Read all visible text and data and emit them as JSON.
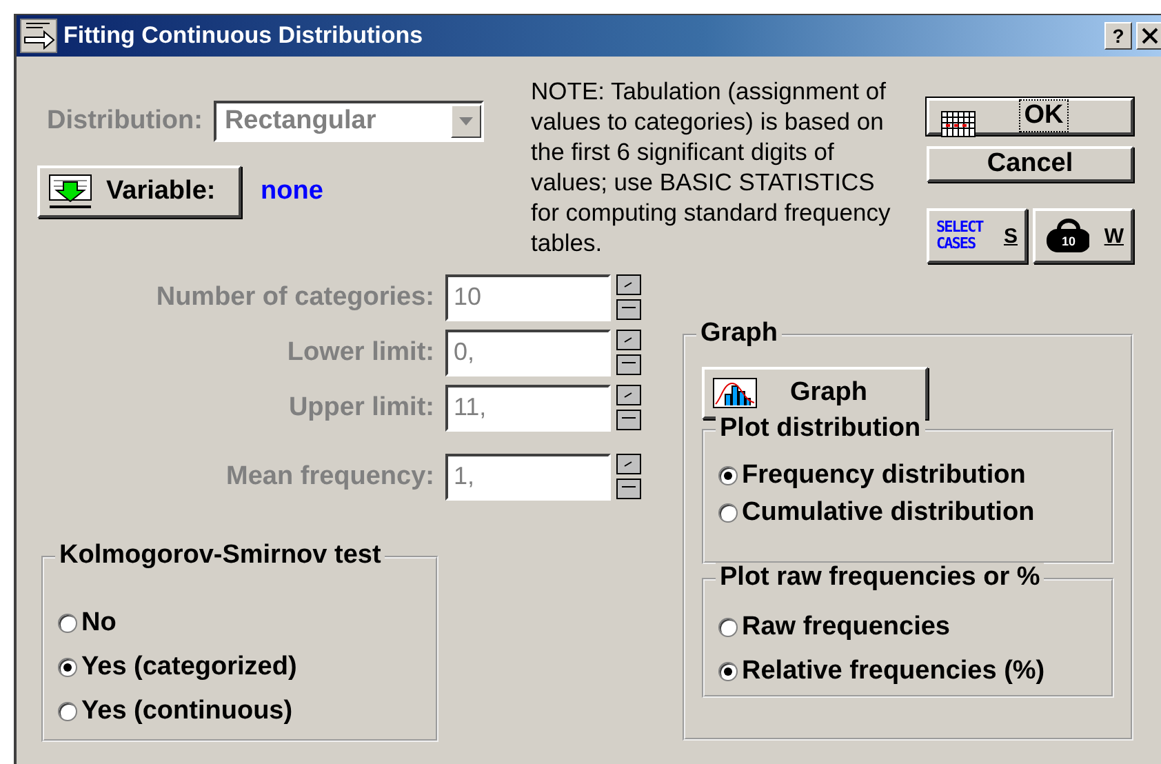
{
  "window": {
    "title": "Fitting Continuous Distributions",
    "help": "?"
  },
  "distribution": {
    "label": "Distribution:",
    "value": "Rectangular",
    "disabled": true
  },
  "variable": {
    "button": "Variable:",
    "value": "none"
  },
  "note_lines": [
    "NOTE: Tabulation (assignment of",
    "values to categories) is based on",
    "the first 6 significant digits of",
    "values; use BASIC STATISTICS",
    "for computing standard frequency",
    "tables."
  ],
  "buttons": [
    {
      "kind": "ok",
      "label": "OK",
      "default": true
    },
    {
      "kind": "cancel",
      "label": "Cancel",
      "default": false
    }
  ],
  "tool_buttons": [
    {
      "kind": "select_cases",
      "caption": "SELECT CASES",
      "label": "S"
    },
    {
      "kind": "weight",
      "caption": "10",
      "label": "W"
    }
  ],
  "fields": [
    {
      "label": "Number of categories:",
      "value": "10",
      "disabled": true
    },
    {
      "label": "Lower limit:",
      "value": "0,",
      "disabled": true
    },
    {
      "label": "Upper limit:",
      "value": "11,",
      "disabled": true
    },
    {
      "label": "Mean frequency:",
      "value": "1,",
      "disabled": true
    }
  ],
  "ks_test": {
    "title": "Kolmogorov-Smirnov test",
    "options": [
      {
        "label": "No",
        "selected": false
      },
      {
        "label": "Yes (categorized)",
        "selected": true
      },
      {
        "label": "Yes (continuous)",
        "selected": false
      }
    ]
  },
  "graph": {
    "title": "Graph",
    "button": "Graph",
    "groups": [
      {
        "title": "Plot distribution",
        "options": [
          {
            "label": "Frequency distribution",
            "selected": true
          },
          {
            "label": "Cumulative distribution",
            "selected": false
          }
        ]
      },
      {
        "title": "Plot raw frequencies or %",
        "options": [
          {
            "label": "Raw frequencies",
            "selected": false
          },
          {
            "label": "Relative frequencies (%)",
            "selected": true
          }
        ]
      }
    ]
  }
}
